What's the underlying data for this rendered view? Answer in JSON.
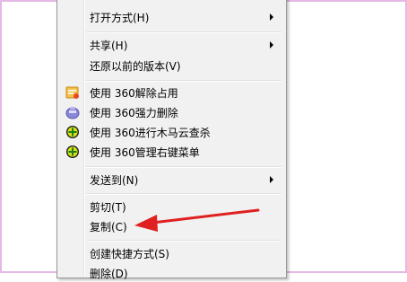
{
  "menu": {
    "items": [
      {
        "label": "打开方式(H)",
        "has_submenu": true
      },
      {
        "label": "共享(H)",
        "has_submenu": true
      },
      {
        "label": "还原以前的版本(V)",
        "has_submenu": false
      },
      {
        "label": "使用 360解除占用",
        "icon": "360-unlock-icon"
      },
      {
        "label": "使用 360强力删除",
        "icon": "360-force-delete-icon"
      },
      {
        "label": "使用 360进行木马云查杀",
        "icon": "360-trojan-scan-icon"
      },
      {
        "label": "使用 360管理右键菜单",
        "icon": "360-menu-manager-icon"
      },
      {
        "label": "发送到(N)",
        "has_submenu": true
      },
      {
        "label": "剪切(T)"
      },
      {
        "label": "复制(C)"
      },
      {
        "label": "创建快捷方式(S)"
      },
      {
        "label": "删除(D)"
      }
    ]
  },
  "annotation": {
    "color": "#e02020"
  }
}
